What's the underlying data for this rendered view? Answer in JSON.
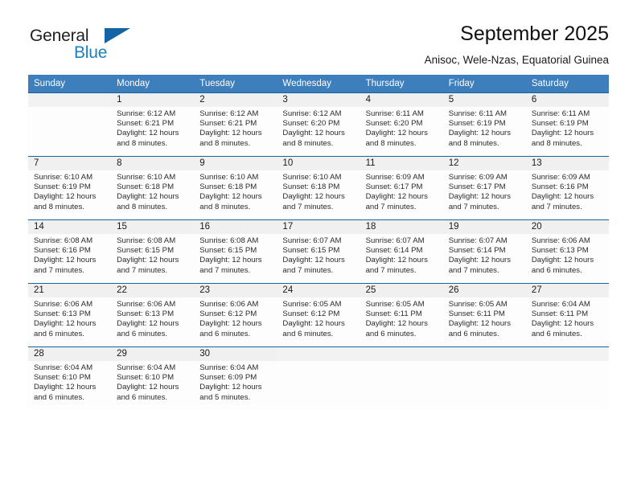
{
  "brand": {
    "name_top": "General",
    "name_bottom": "Blue",
    "triangle_icon": "triangle-logo-icon",
    "color_top": "#231f20",
    "color_bottom": "#1d7fc3",
    "color_triangle": "#1464a5"
  },
  "header": {
    "title": "September 2025",
    "subtitle": "Anisoc, Wele-Nzas, Equatorial Guinea"
  },
  "theme": {
    "header_blue": "#3d7ebd",
    "rule_blue": "#16639e",
    "daynum_band": "#f0f0f0"
  },
  "calendar": {
    "weekday_headers": [
      "Sunday",
      "Monday",
      "Tuesday",
      "Wednesday",
      "Thursday",
      "Friday",
      "Saturday"
    ],
    "weeks": [
      [
        {
          "day": "",
          "sunrise": "",
          "sunset": "",
          "daylight_line1": "",
          "daylight_line2": ""
        },
        {
          "day": "1",
          "sunrise": "Sunrise: 6:12 AM",
          "sunset": "Sunset: 6:21 PM",
          "daylight_line1": "Daylight: 12 hours",
          "daylight_line2": "and 8 minutes."
        },
        {
          "day": "2",
          "sunrise": "Sunrise: 6:12 AM",
          "sunset": "Sunset: 6:21 PM",
          "daylight_line1": "Daylight: 12 hours",
          "daylight_line2": "and 8 minutes."
        },
        {
          "day": "3",
          "sunrise": "Sunrise: 6:12 AM",
          "sunset": "Sunset: 6:20 PM",
          "daylight_line1": "Daylight: 12 hours",
          "daylight_line2": "and 8 minutes."
        },
        {
          "day": "4",
          "sunrise": "Sunrise: 6:11 AM",
          "sunset": "Sunset: 6:20 PM",
          "daylight_line1": "Daylight: 12 hours",
          "daylight_line2": "and 8 minutes."
        },
        {
          "day": "5",
          "sunrise": "Sunrise: 6:11 AM",
          "sunset": "Sunset: 6:19 PM",
          "daylight_line1": "Daylight: 12 hours",
          "daylight_line2": "and 8 minutes."
        },
        {
          "day": "6",
          "sunrise": "Sunrise: 6:11 AM",
          "sunset": "Sunset: 6:19 PM",
          "daylight_line1": "Daylight: 12 hours",
          "daylight_line2": "and 8 minutes."
        }
      ],
      [
        {
          "day": "7",
          "sunrise": "Sunrise: 6:10 AM",
          "sunset": "Sunset: 6:19 PM",
          "daylight_line1": "Daylight: 12 hours",
          "daylight_line2": "and 8 minutes."
        },
        {
          "day": "8",
          "sunrise": "Sunrise: 6:10 AM",
          "sunset": "Sunset: 6:18 PM",
          "daylight_line1": "Daylight: 12 hours",
          "daylight_line2": "and 8 minutes."
        },
        {
          "day": "9",
          "sunrise": "Sunrise: 6:10 AM",
          "sunset": "Sunset: 6:18 PM",
          "daylight_line1": "Daylight: 12 hours",
          "daylight_line2": "and 8 minutes."
        },
        {
          "day": "10",
          "sunrise": "Sunrise: 6:10 AM",
          "sunset": "Sunset: 6:18 PM",
          "daylight_line1": "Daylight: 12 hours",
          "daylight_line2": "and 7 minutes."
        },
        {
          "day": "11",
          "sunrise": "Sunrise: 6:09 AM",
          "sunset": "Sunset: 6:17 PM",
          "daylight_line1": "Daylight: 12 hours",
          "daylight_line2": "and 7 minutes."
        },
        {
          "day": "12",
          "sunrise": "Sunrise: 6:09 AM",
          "sunset": "Sunset: 6:17 PM",
          "daylight_line1": "Daylight: 12 hours",
          "daylight_line2": "and 7 minutes."
        },
        {
          "day": "13",
          "sunrise": "Sunrise: 6:09 AM",
          "sunset": "Sunset: 6:16 PM",
          "daylight_line1": "Daylight: 12 hours",
          "daylight_line2": "and 7 minutes."
        }
      ],
      [
        {
          "day": "14",
          "sunrise": "Sunrise: 6:08 AM",
          "sunset": "Sunset: 6:16 PM",
          "daylight_line1": "Daylight: 12 hours",
          "daylight_line2": "and 7 minutes."
        },
        {
          "day": "15",
          "sunrise": "Sunrise: 6:08 AM",
          "sunset": "Sunset: 6:15 PM",
          "daylight_line1": "Daylight: 12 hours",
          "daylight_line2": "and 7 minutes."
        },
        {
          "day": "16",
          "sunrise": "Sunrise: 6:08 AM",
          "sunset": "Sunset: 6:15 PM",
          "daylight_line1": "Daylight: 12 hours",
          "daylight_line2": "and 7 minutes."
        },
        {
          "day": "17",
          "sunrise": "Sunrise: 6:07 AM",
          "sunset": "Sunset: 6:15 PM",
          "daylight_line1": "Daylight: 12 hours",
          "daylight_line2": "and 7 minutes."
        },
        {
          "day": "18",
          "sunrise": "Sunrise: 6:07 AM",
          "sunset": "Sunset: 6:14 PM",
          "daylight_line1": "Daylight: 12 hours",
          "daylight_line2": "and 7 minutes."
        },
        {
          "day": "19",
          "sunrise": "Sunrise: 6:07 AM",
          "sunset": "Sunset: 6:14 PM",
          "daylight_line1": "Daylight: 12 hours",
          "daylight_line2": "and 7 minutes."
        },
        {
          "day": "20",
          "sunrise": "Sunrise: 6:06 AM",
          "sunset": "Sunset: 6:13 PM",
          "daylight_line1": "Daylight: 12 hours",
          "daylight_line2": "and 6 minutes."
        }
      ],
      [
        {
          "day": "21",
          "sunrise": "Sunrise: 6:06 AM",
          "sunset": "Sunset: 6:13 PM",
          "daylight_line1": "Daylight: 12 hours",
          "daylight_line2": "and 6 minutes."
        },
        {
          "day": "22",
          "sunrise": "Sunrise: 6:06 AM",
          "sunset": "Sunset: 6:13 PM",
          "daylight_line1": "Daylight: 12 hours",
          "daylight_line2": "and 6 minutes."
        },
        {
          "day": "23",
          "sunrise": "Sunrise: 6:06 AM",
          "sunset": "Sunset: 6:12 PM",
          "daylight_line1": "Daylight: 12 hours",
          "daylight_line2": "and 6 minutes."
        },
        {
          "day": "24",
          "sunrise": "Sunrise: 6:05 AM",
          "sunset": "Sunset: 6:12 PM",
          "daylight_line1": "Daylight: 12 hours",
          "daylight_line2": "and 6 minutes."
        },
        {
          "day": "25",
          "sunrise": "Sunrise: 6:05 AM",
          "sunset": "Sunset: 6:11 PM",
          "daylight_line1": "Daylight: 12 hours",
          "daylight_line2": "and 6 minutes."
        },
        {
          "day": "26",
          "sunrise": "Sunrise: 6:05 AM",
          "sunset": "Sunset: 6:11 PM",
          "daylight_line1": "Daylight: 12 hours",
          "daylight_line2": "and 6 minutes."
        },
        {
          "day": "27",
          "sunrise": "Sunrise: 6:04 AM",
          "sunset": "Sunset: 6:11 PM",
          "daylight_line1": "Daylight: 12 hours",
          "daylight_line2": "and 6 minutes."
        }
      ],
      [
        {
          "day": "28",
          "sunrise": "Sunrise: 6:04 AM",
          "sunset": "Sunset: 6:10 PM",
          "daylight_line1": "Daylight: 12 hours",
          "daylight_line2": "and 6 minutes."
        },
        {
          "day": "29",
          "sunrise": "Sunrise: 6:04 AM",
          "sunset": "Sunset: 6:10 PM",
          "daylight_line1": "Daylight: 12 hours",
          "daylight_line2": "and 6 minutes."
        },
        {
          "day": "30",
          "sunrise": "Sunrise: 6:04 AM",
          "sunset": "Sunset: 6:09 PM",
          "daylight_line1": "Daylight: 12 hours",
          "daylight_line2": "and 5 minutes."
        },
        {
          "day": "",
          "sunrise": "",
          "sunset": "",
          "daylight_line1": "",
          "daylight_line2": ""
        },
        {
          "day": "",
          "sunrise": "",
          "sunset": "",
          "daylight_line1": "",
          "daylight_line2": ""
        },
        {
          "day": "",
          "sunrise": "",
          "sunset": "",
          "daylight_line1": "",
          "daylight_line2": ""
        },
        {
          "day": "",
          "sunrise": "",
          "sunset": "",
          "daylight_line1": "",
          "daylight_line2": ""
        }
      ]
    ]
  }
}
